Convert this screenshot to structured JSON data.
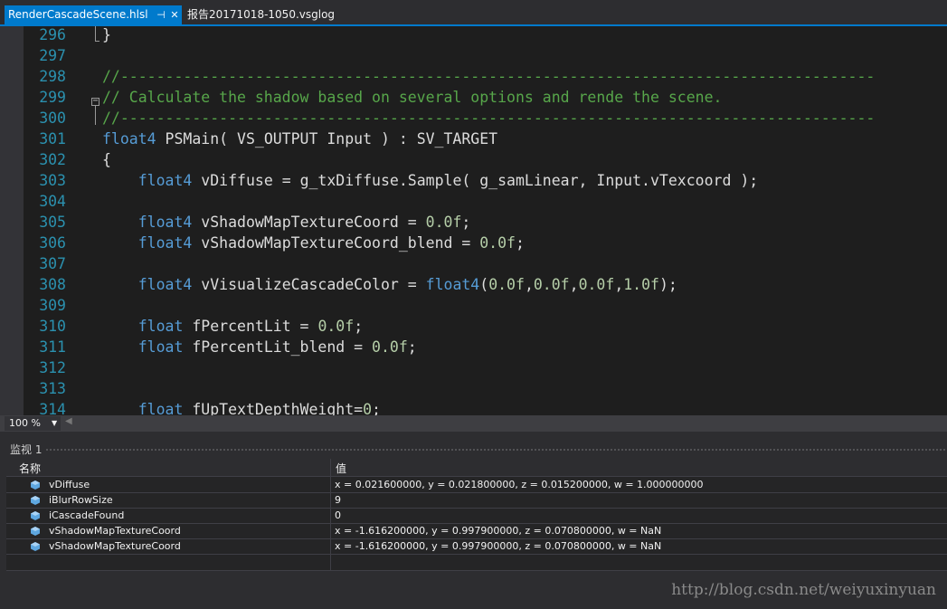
{
  "tabs": {
    "active_label": "RenderCascadeScene.hlsl",
    "pin_glyph": "⊣",
    "close_glyph": "✕",
    "inactive_label": "报告20171018-1050.vsglog"
  },
  "code_lines": [
    {
      "n": "296",
      "tokens": [
        {
          "t": "}",
          "c": "p"
        }
      ]
    },
    {
      "n": "297",
      "tokens": []
    },
    {
      "n": "298",
      "tokens": [
        {
          "t": "//------------------------------------------------------------------------------------",
          "c": "cmt"
        }
      ]
    },
    {
      "n": "299",
      "tokens": [
        {
          "t": "// Calculate the shadow based on several options and rende the scene.",
          "c": "cmt"
        }
      ]
    },
    {
      "n": "300",
      "tokens": [
        {
          "t": "//------------------------------------------------------------------------------------",
          "c": "cmt"
        }
      ]
    },
    {
      "n": "301",
      "tokens": [
        {
          "t": "float4",
          "c": "kw"
        },
        {
          "t": " PSMain( VS_OUTPUT Input ) : SV_TARGET",
          "c": "p"
        }
      ]
    },
    {
      "n": "302",
      "tokens": [
        {
          "t": "{",
          "c": "p"
        }
      ]
    },
    {
      "n": "303",
      "tokens": [
        {
          "t": "    ",
          "c": "p"
        },
        {
          "t": "float4",
          "c": "kw"
        },
        {
          "t": " vDiffuse = g_txDiffuse.Sample( g_samLinear, Input.vTexcoord );",
          "c": "p"
        }
      ]
    },
    {
      "n": "304",
      "tokens": []
    },
    {
      "n": "305",
      "tokens": [
        {
          "t": "    ",
          "c": "p"
        },
        {
          "t": "float4",
          "c": "kw"
        },
        {
          "t": " vShadowMapTextureCoord = ",
          "c": "p"
        },
        {
          "t": "0.0f",
          "c": "num"
        },
        {
          "t": ";",
          "c": "p"
        }
      ]
    },
    {
      "n": "306",
      "tokens": [
        {
          "t": "    ",
          "c": "p"
        },
        {
          "t": "float4",
          "c": "kw"
        },
        {
          "t": " vShadowMapTextureCoord_blend = ",
          "c": "p"
        },
        {
          "t": "0.0f",
          "c": "num"
        },
        {
          "t": ";",
          "c": "p"
        }
      ]
    },
    {
      "n": "307",
      "tokens": []
    },
    {
      "n": "308",
      "tokens": [
        {
          "t": "    ",
          "c": "p"
        },
        {
          "t": "float4",
          "c": "kw"
        },
        {
          "t": " vVisualizeCascadeColor = ",
          "c": "p"
        },
        {
          "t": "float4",
          "c": "kw"
        },
        {
          "t": "(",
          "c": "p"
        },
        {
          "t": "0.0f",
          "c": "num"
        },
        {
          "t": ",",
          "c": "p"
        },
        {
          "t": "0.0f",
          "c": "num"
        },
        {
          "t": ",",
          "c": "p"
        },
        {
          "t": "0.0f",
          "c": "num"
        },
        {
          "t": ",",
          "c": "p"
        },
        {
          "t": "1.0f",
          "c": "num"
        },
        {
          "t": ");",
          "c": "p"
        }
      ]
    },
    {
      "n": "309",
      "tokens": []
    },
    {
      "n": "310",
      "tokens": [
        {
          "t": "    ",
          "c": "p"
        },
        {
          "t": "float",
          "c": "kw"
        },
        {
          "t": " fPercentLit = ",
          "c": "p"
        },
        {
          "t": "0.0f",
          "c": "num"
        },
        {
          "t": ";",
          "c": "p"
        }
      ]
    },
    {
      "n": "311",
      "tokens": [
        {
          "t": "    ",
          "c": "p"
        },
        {
          "t": "float",
          "c": "kw"
        },
        {
          "t": " fPercentLit_blend = ",
          "c": "p"
        },
        {
          "t": "0.0f",
          "c": "num"
        },
        {
          "t": ";",
          "c": "p"
        }
      ]
    },
    {
      "n": "312",
      "tokens": []
    },
    {
      "n": "313",
      "tokens": []
    },
    {
      "n": "314",
      "tokens": [
        {
          "t": "    ",
          "c": "p"
        },
        {
          "t": "float",
          "c": "kw"
        },
        {
          "t": " fUpTextDepthWeight=",
          "c": "p"
        },
        {
          "t": "0",
          "c": "num"
        },
        {
          "t": ";",
          "c": "p"
        }
      ]
    }
  ],
  "zoom": {
    "value": "100 %",
    "arrow": "▼",
    "scroll_left": "◀"
  },
  "watch": {
    "title": "监视 1",
    "col_name": "名称",
    "col_value": "值",
    "rows": [
      {
        "name": "vDiffuse",
        "value": "x = 0.021600000, y = 0.021800000, z = 0.015200000, w = 1.000000000"
      },
      {
        "name": "iBlurRowSize",
        "value": "9"
      },
      {
        "name": "iCascadeFound",
        "value": "0"
      },
      {
        "name": "vShadowMapTextureCoord",
        "value": "x = -1.616200000, y = 0.997900000, z = 0.070800000, w = NaN"
      },
      {
        "name": "vShadowMapTextureCoord",
        "value": "x = -1.616200000, y = 0.997900000, z = 0.070800000, w = NaN"
      }
    ]
  },
  "watermark": "http://blog.csdn.net/weiyuxinyuan",
  "colors": {
    "accent": "#007acc",
    "editor_bg": "#1e1e1e",
    "keyword": "#569cd6",
    "comment": "#57a64a",
    "number": "#b5cea8",
    "line_number": "#2b91af",
    "variable_icon": "#5ea7e0"
  }
}
